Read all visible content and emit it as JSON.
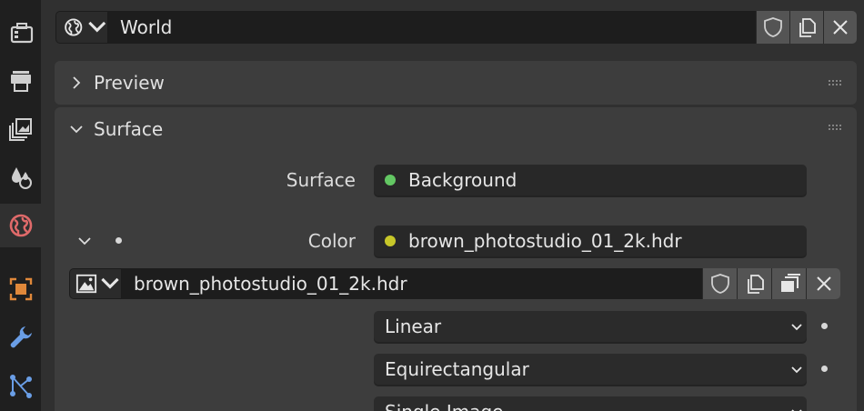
{
  "sidebar": {
    "tabs": [
      {
        "id": "tool",
        "icon": "toolbox-icon"
      },
      {
        "id": "render",
        "icon": "printer-icon"
      },
      {
        "id": "output",
        "icon": "image-stack-icon"
      },
      {
        "id": "view-layer",
        "icon": "drops-icon"
      },
      {
        "id": "world",
        "icon": "world-icon",
        "active": true
      },
      {
        "id": "object",
        "icon": "object-icon"
      },
      {
        "id": "modifier",
        "icon": "wrench-icon"
      },
      {
        "id": "particles",
        "icon": "node-icon"
      }
    ]
  },
  "world_block": {
    "name": "World",
    "buttons": [
      "fake-user-icon",
      "duplicate-icon",
      "unlink-icon"
    ]
  },
  "preview_panel": {
    "title": "Preview",
    "expanded": false
  },
  "surface_panel": {
    "title": "Surface",
    "expanded": true,
    "surface_label": "Surface",
    "surface_value": "Background",
    "surface_dot_color": "#63c763",
    "color_label": "Color",
    "color_value": "brown_photostudio_01_2k.hdr",
    "color_dot_color": "#c7c729",
    "image_name": "brown_photostudio_01_2k.hdr",
    "interpolation": "Linear",
    "projection": "Equirectangular",
    "source": "Single Image"
  },
  "colors": {
    "world_icon": "#e06a6a",
    "object_icon": "#e0883a",
    "modifier_icon": "#6a9ee6"
  }
}
